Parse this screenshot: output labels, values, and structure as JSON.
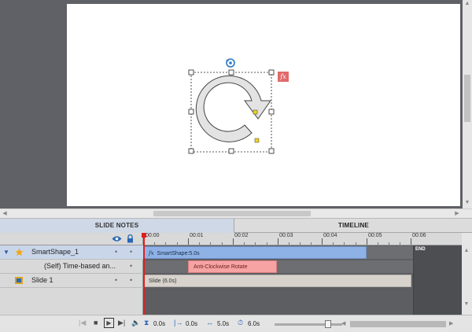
{
  "stage": {
    "fx_badge": "fx"
  },
  "tabs": {
    "slide_notes": "SLIDE NOTES",
    "timeline": "TIMELINE"
  },
  "ruler": {
    "ticks": [
      "00:00",
      "00:01",
      "00:02",
      "00:03",
      "00:04",
      "00:05",
      "00:06"
    ]
  },
  "layers": [
    {
      "name": "SmartShape_1",
      "icon": "star-icon"
    },
    {
      "name": "(Self) Time-based an..."
    },
    {
      "name": "Slide 1",
      "icon": "slide-icon"
    }
  ],
  "tracks": {
    "shape_bar": "SmartShape:5.0s",
    "shape_bar_prefix": "fx",
    "effect_bar": "Anti-Clockwise Rotate",
    "slide_bar": "Slide (6.0s)",
    "end_label": "END"
  },
  "toolbar": {
    "current_time": "0.0s",
    "start_time": "0.0s",
    "duration": "5.0s",
    "slide_duration": "6.0s"
  },
  "colors": {
    "accent_red": "#e21d1d",
    "shape_bar": "#8fb2e6",
    "effect_bar": "#f7a3a3",
    "slide_bar": "#d7d3cc"
  }
}
